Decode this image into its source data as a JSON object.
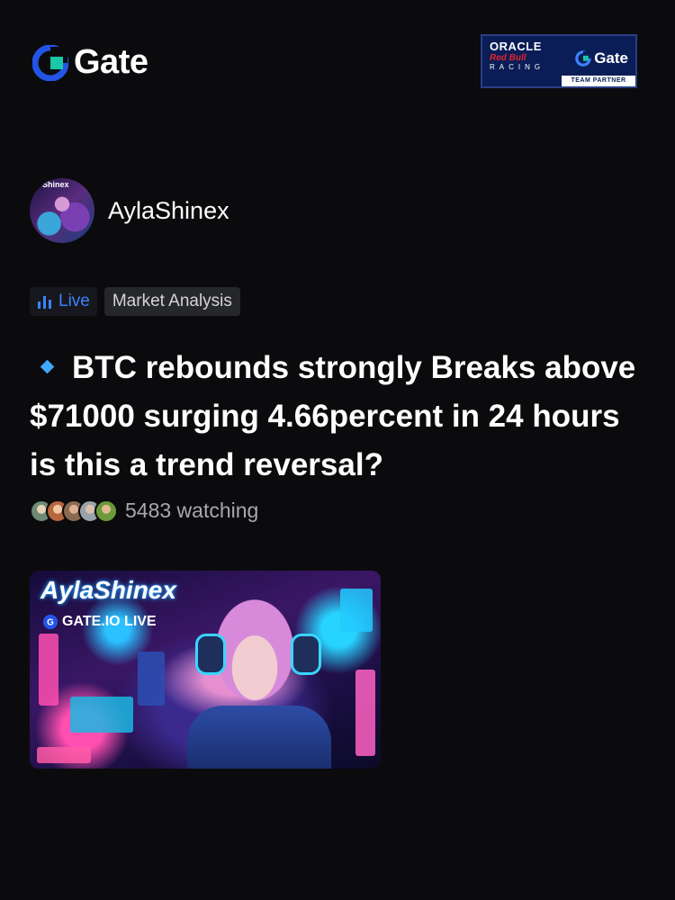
{
  "brand": {
    "name": "Gate",
    "accent": "#2354e6",
    "accent2": "#18c8a6"
  },
  "partner_badge": {
    "line1": "ORACLE",
    "line2": "Red Bull",
    "line3": "RACING",
    "brand": "Gate",
    "footer": "TEAM PARTNER"
  },
  "streamer": {
    "name": "AylaShinex",
    "avatar_label": "Shinex"
  },
  "tags": {
    "live": "Live",
    "category": "Market Analysis"
  },
  "headline": "BTC rebounds strongly Breaks above $71000 surging 4.66percent in 24 hours  is this a trend reversal?",
  "watching": {
    "label": "5483 watching",
    "avatar_colors": [
      "#6d8b74",
      "#b4673c",
      "#8a6a52",
      "#9aa3a9",
      "#6b9a3a"
    ]
  },
  "thumbnail": {
    "title": "AylaShinex",
    "subtitle": "GATE.IO LIVE"
  }
}
